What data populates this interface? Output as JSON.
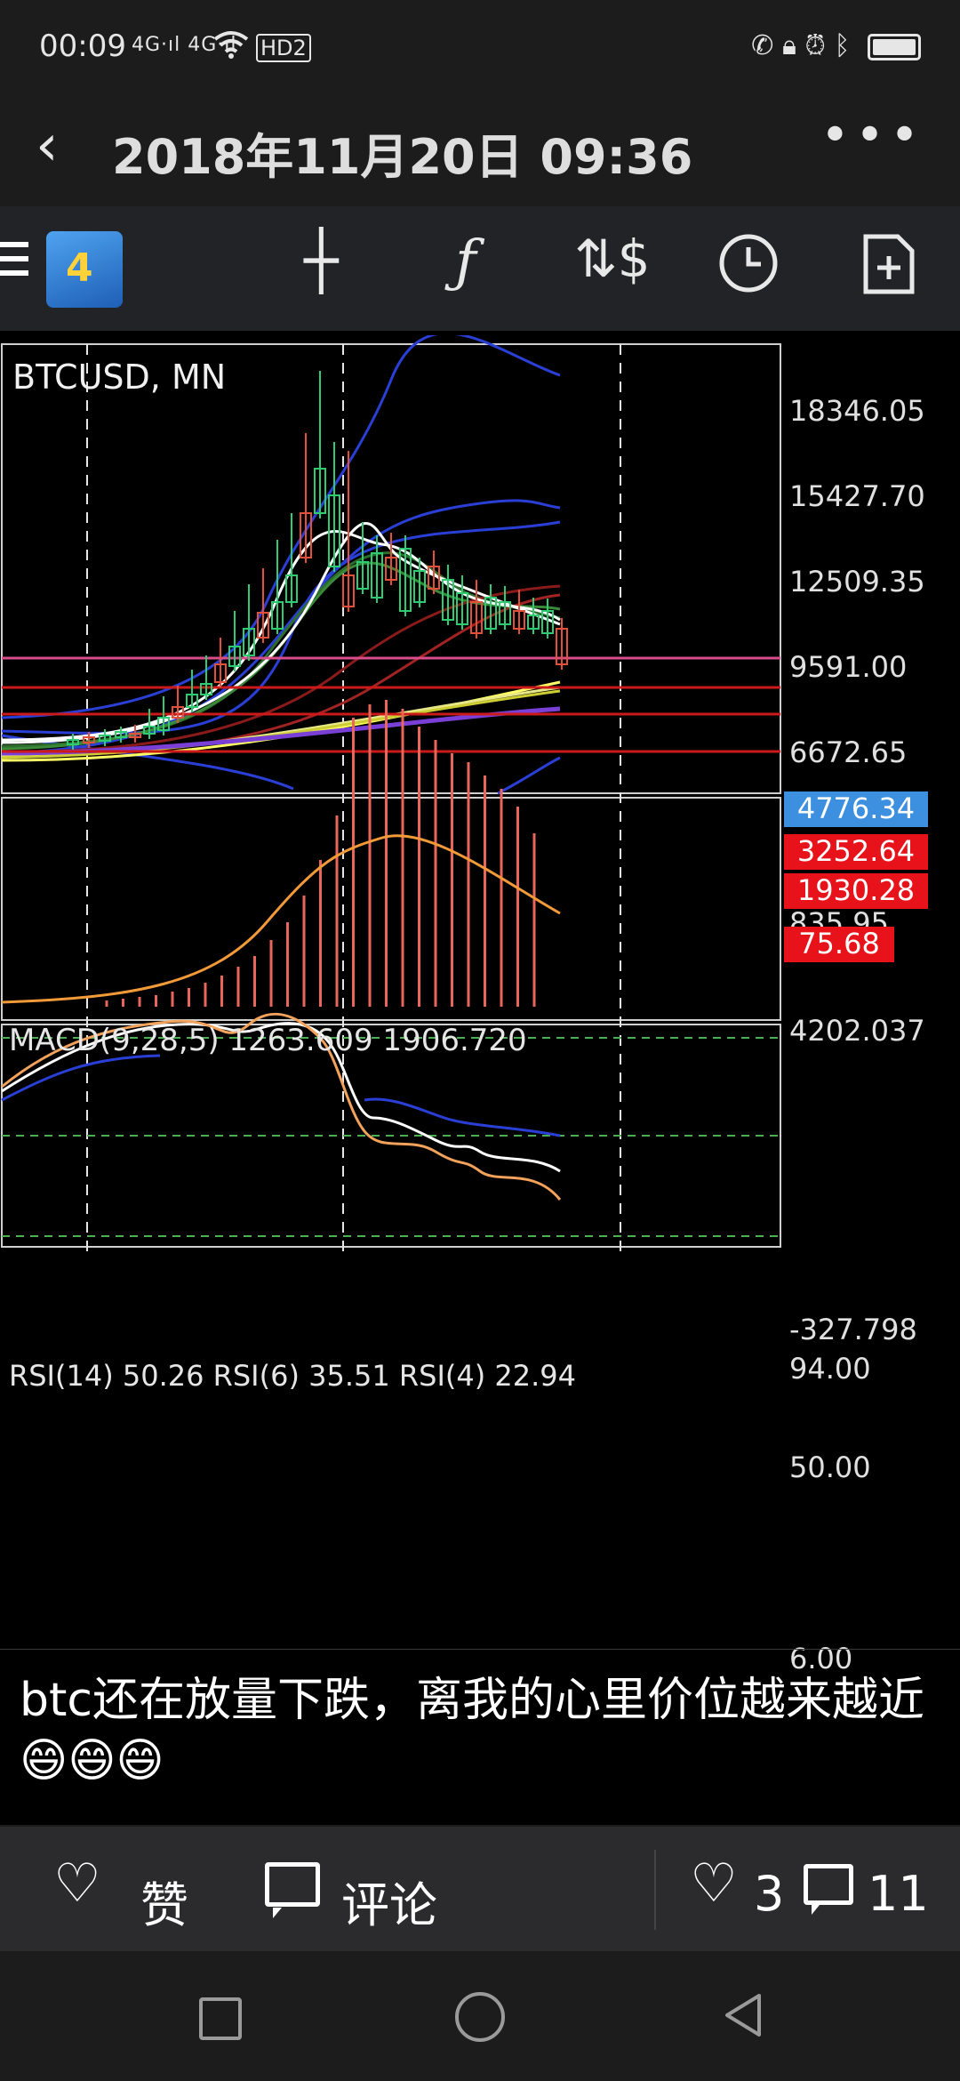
{
  "status_bar": {
    "time": "00:09",
    "network": "4G·ıl 4G·ıl",
    "wifi": "HD2",
    "icons": [
      "vibrate-icon",
      "lock-icon",
      "alarm-icon",
      "bluetooth-icon",
      "battery-icon"
    ]
  },
  "header": {
    "title": "2018年11月20日 09:36"
  },
  "mt4": {
    "toolbar_icons": [
      "crosshair-icon",
      "function-icon",
      "trade-icon",
      "clock-icon",
      "add-chart-icon"
    ],
    "symbol": "BTCUSD, MN",
    "price_axis": [
      "18346.05",
      "15427.70",
      "12509.35",
      "9591.00",
      "6672.65",
      "835.95"
    ],
    "tags": [
      {
        "label": "4776.34",
        "bg": "#3d8fe0"
      },
      {
        "label": "3252.64",
        "bg": "#e8121a"
      },
      {
        "label": "1930.28",
        "bg": "#e8121a"
      },
      {
        "label": "75.68",
        "bg": "#e8121a"
      }
    ],
    "macd": {
      "label": "MACD(9,28,5) 1263.609 1906.720",
      "axis_top": "4202.037",
      "axis_bottom": "-327.798"
    },
    "rsi": {
      "label": "RSI(14) 50.26 RSI(6) 35.51 RSI(4) 22.94",
      "levels": [
        "94.00",
        "50.00",
        "6.00"
      ]
    }
  },
  "caption": "btc还在放量下跌，离我的心里价位越来越近😄😄😄",
  "actions": {
    "like_label": "赞",
    "comment_label": "评论",
    "like_count": "3",
    "comment_count": "11"
  },
  "colors": {
    "bull": "#2ecc71",
    "bear": "#e2503a",
    "bollinger": "#2a3fd6"
  }
}
